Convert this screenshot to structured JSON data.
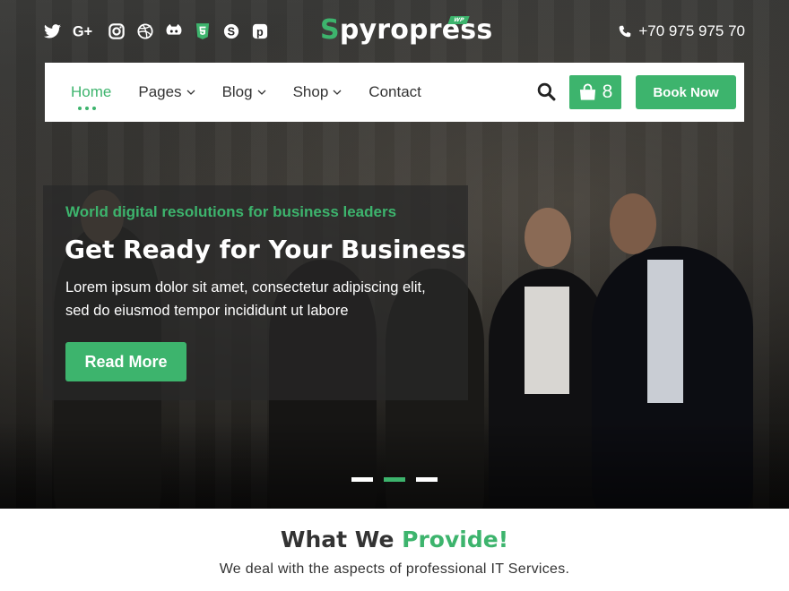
{
  "brand": {
    "logo_initial": "S",
    "logo_rest": "pyropress",
    "logo_badge": "WP",
    "accent": "#3db46d"
  },
  "social": [
    "twitter-icon",
    "google-plus-icon",
    "instagram-icon",
    "dribbble-icon",
    "github-icon",
    "html5-icon",
    "skype-icon",
    "pinterest-icon"
  ],
  "contact": {
    "phone": "+70 975 975 70"
  },
  "nav": {
    "items": [
      {
        "label": "Home"
      },
      {
        "label": "Pages"
      },
      {
        "label": "Blog"
      },
      {
        "label": "Shop"
      },
      {
        "label": "Contact"
      }
    ],
    "cart_count": "8",
    "book_label": "Book Now"
  },
  "hero": {
    "tagline": "World digital resolutions for business leaders",
    "title": "Get Ready for Your Business",
    "text": "Lorem ipsum dolor sit amet, consectetur adipiscing elit, sed do eiusmod tempor incididunt ut labore",
    "button": "Read More",
    "active_slide": 2
  },
  "section": {
    "title_prefix": "What We",
    "title_accent": "Provide!",
    "subtitle": "We deal with the aspects of professional IT Services."
  }
}
